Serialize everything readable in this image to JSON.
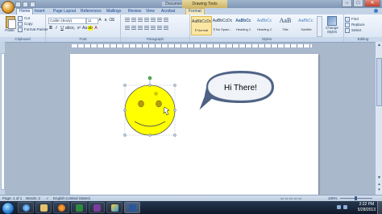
{
  "window": {
    "title": "Document1 - Microsoft Word",
    "contextual_tab_group": "Drawing Tools",
    "controls": [
      "–",
      "□",
      "✕"
    ]
  },
  "tabs": [
    "Home",
    "Insert",
    "Page Layout",
    "References",
    "Mailings",
    "Review",
    "View",
    "Acrobat",
    "Format"
  ],
  "ribbon": {
    "clipboard": {
      "label": "Clipboard",
      "paste": "Paste",
      "cut": "Cut",
      "copy": "Copy",
      "format_painter": "Format Painter"
    },
    "font": {
      "label": "Font",
      "font_name": "Calibri (Body)",
      "font_size": "11"
    },
    "paragraph": {
      "label": "Paragraph"
    },
    "styles": {
      "label": "Styles",
      "items": [
        {
          "preview": "AaBbCcDc",
          "name": "¶ Normal"
        },
        {
          "preview": "AaBbCcDc",
          "name": "¶ No Spaci..."
        },
        {
          "preview": "AaBbCc",
          "name": "Heading 1"
        },
        {
          "preview": "AaBbCc",
          "name": "Heading 2"
        },
        {
          "preview": "AaB",
          "name": "Title"
        },
        {
          "preview": "AaBbCc.",
          "name": "Subtitle"
        }
      ],
      "change_styles": "Change Styles"
    },
    "editing": {
      "label": "Editing",
      "find": "Find",
      "replace": "Replace",
      "select": "Select"
    }
  },
  "document": {
    "callout_text": "Hi There!",
    "colors": {
      "smiley_fill": "#ffff00",
      "callout_fill": "#4f6284"
    }
  },
  "status": {
    "page": "Page: 1 of 1",
    "words": "Words: 2",
    "language": "English (United States)",
    "zoom": "100%"
  },
  "taskbar": {
    "time": "2:22 PM",
    "date": "5/28/2013"
  }
}
